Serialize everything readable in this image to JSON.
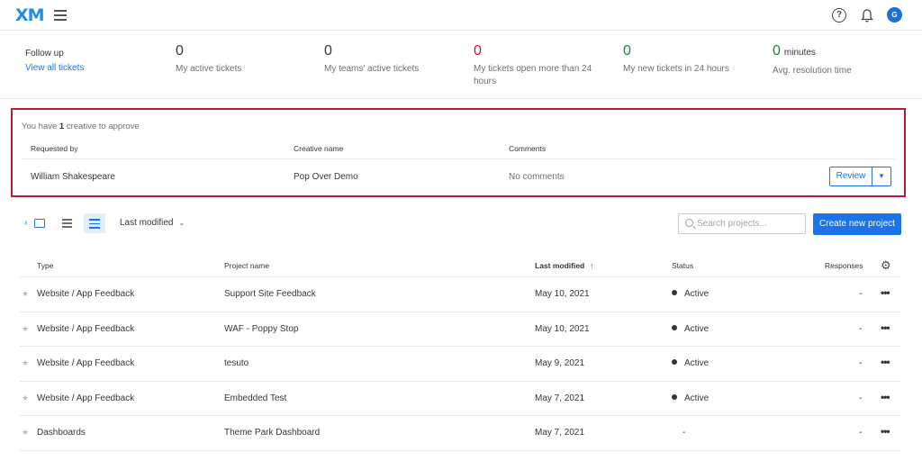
{
  "topbar": {
    "logo": "XM",
    "avatar_initial": "G",
    "help_glyph": "?"
  },
  "followup": {
    "title": "Follow up",
    "link": "View all tickets"
  },
  "stats": [
    {
      "value": "0",
      "unit": "",
      "label": "My active tickets",
      "color": "#32363a"
    },
    {
      "value": "0",
      "unit": "",
      "label": "My teams' active tickets",
      "color": "#32363a"
    },
    {
      "value": "0",
      "unit": "",
      "label": "My tickets open more than 24 hours",
      "color": "#c8102e"
    },
    {
      "value": "0",
      "unit": "",
      "label": "My new tickets in 24 hours",
      "color": "#0b8a3c"
    },
    {
      "value": "0",
      "unit": "minutes",
      "label": "Avg. resolution time",
      "color": "#0b8a3c"
    }
  ],
  "approval": {
    "msg_prefix": "You have",
    "count": "1",
    "msg_suffix": "creative to approve",
    "headers": {
      "requested_by": "Requested by",
      "creative_name": "Creative name",
      "comments": "Comments"
    },
    "row": {
      "requested_by": "William Shakespeare",
      "creative_name": "Pop Over Demo",
      "comments": "No comments"
    },
    "review_label": "Review",
    "highlight_color": "#b22036"
  },
  "toolbar": {
    "sort_label": "Last modified",
    "search_placeholder": "Search projects...",
    "create_label": "Create new project"
  },
  "table": {
    "headers": {
      "type": "Type",
      "name": "Project name",
      "modified": "Last modified",
      "status": "Status",
      "responses": "Responses"
    },
    "rows": [
      {
        "type": "Website / App Feedback",
        "name": "Support Site Feedback",
        "modified": "May 10, 2021",
        "status": "Active",
        "responses": "-"
      },
      {
        "type": "Website / App Feedback",
        "name": "WAF - Poppy Stop",
        "modified": "May 10, 2021",
        "status": "Active",
        "responses": "-"
      },
      {
        "type": "Website / App Feedback",
        "name": "tesuto",
        "modified": "May 9, 2021",
        "status": "Active",
        "responses": "-"
      },
      {
        "type": "Website / App Feedback",
        "name": "Embedded Test",
        "modified": "May 7, 2021",
        "status": "Active",
        "responses": "-"
      },
      {
        "type": "Dashboards",
        "name": "Theme Park Dashboard",
        "modified": "May 7, 2021",
        "status": "-",
        "responses": "-"
      }
    ]
  },
  "colors": {
    "accent": "#1a73e8",
    "danger": "#c8102e",
    "success": "#0b8a3c"
  }
}
